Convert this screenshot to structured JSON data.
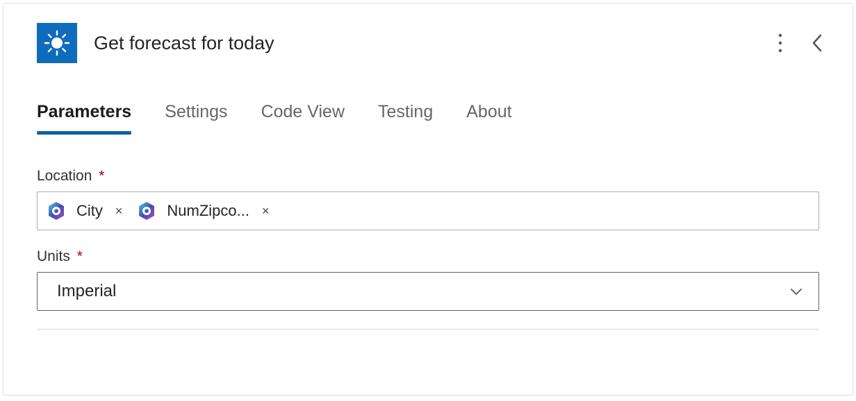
{
  "header": {
    "title": "Get forecast for today",
    "icon_name": "sun-icon"
  },
  "tabs": [
    {
      "label": "Parameters",
      "active": true
    },
    {
      "label": "Settings",
      "active": false
    },
    {
      "label": "Code View",
      "active": false
    },
    {
      "label": "Testing",
      "active": false
    },
    {
      "label": "About",
      "active": false
    }
  ],
  "fields": {
    "location": {
      "label": "Location",
      "required_marker": "*",
      "tokens": [
        {
          "label": "City",
          "icon": "dynamic-content-icon"
        },
        {
          "label": "NumZipco...",
          "icon": "dynamic-content-icon"
        }
      ],
      "remove_symbol": "×"
    },
    "units": {
      "label": "Units",
      "required_marker": "*",
      "value": "Imperial"
    }
  }
}
